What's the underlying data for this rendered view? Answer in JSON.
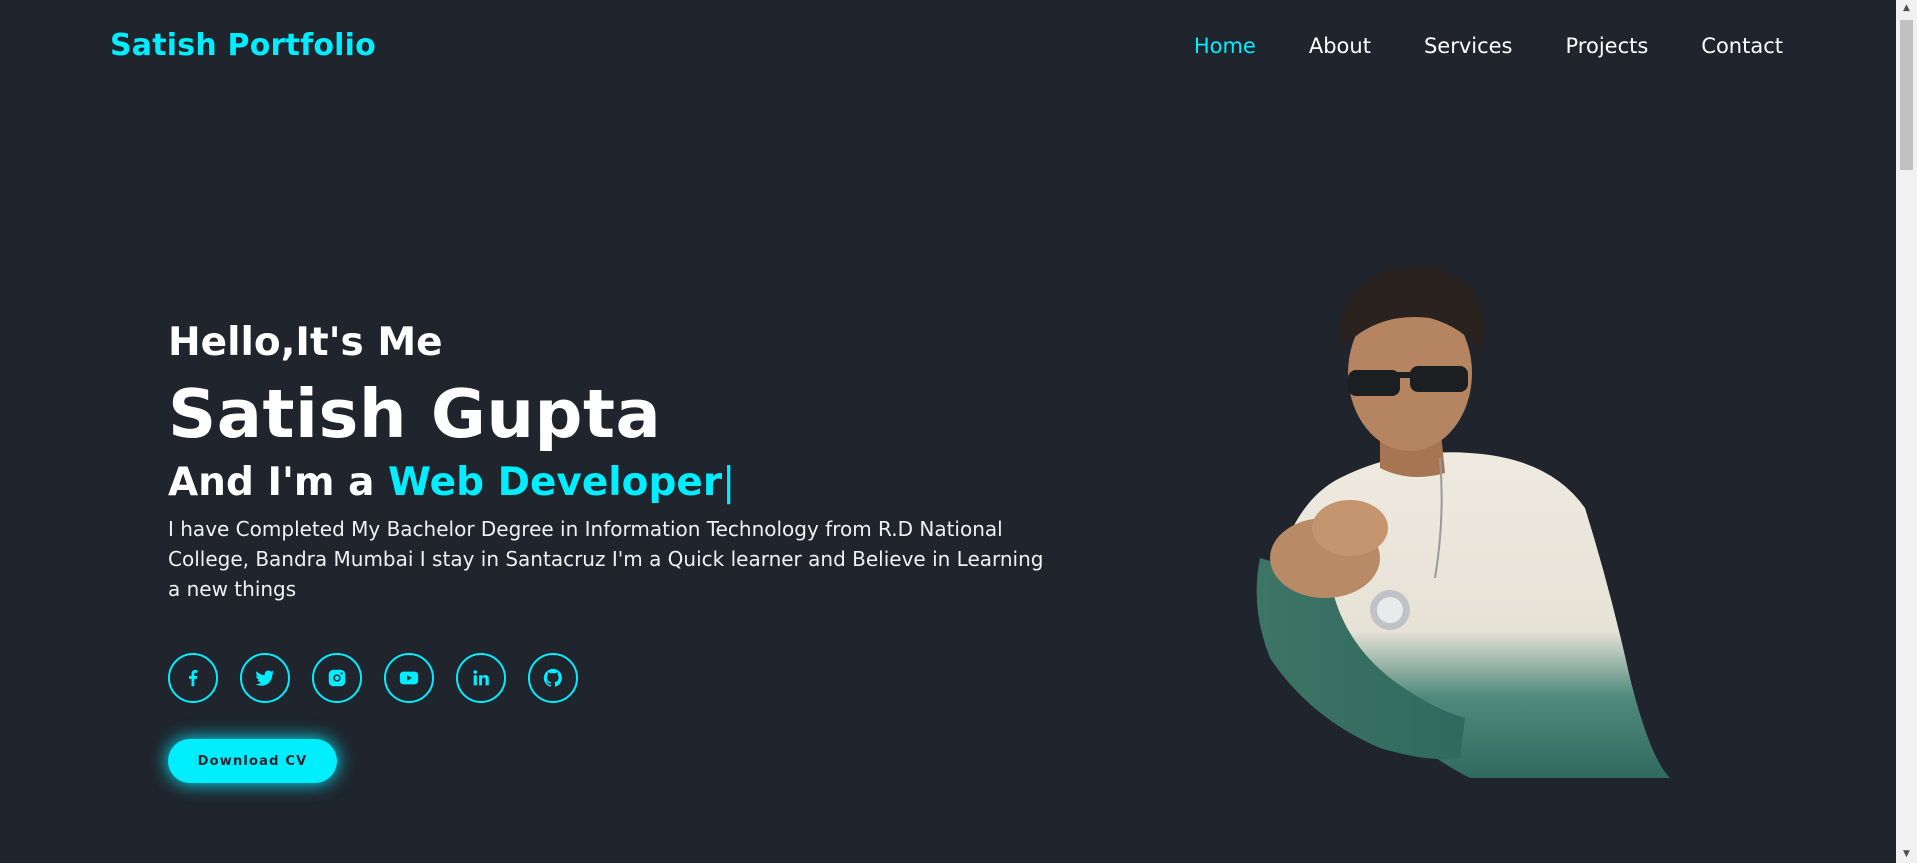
{
  "header": {
    "logo": "Satish Portfolio",
    "nav": [
      {
        "label": "Home",
        "active": true
      },
      {
        "label": "About",
        "active": false
      },
      {
        "label": "Services",
        "active": false
      },
      {
        "label": "Projects",
        "active": false
      },
      {
        "label": "Contact",
        "active": false
      }
    ]
  },
  "hero": {
    "greeting": "Hello,It's Me",
    "name": "Satish Gupta",
    "role_prefix": "And I'm a",
    "role_highlight": "Web Developer",
    "cursor": "|",
    "description": "I have Completed My Bachelor Degree in Information Technology from R.D National College, Bandra Mumbai I stay in Santacruz I'm a Quick learner and Believe in Learning a new things",
    "socials": [
      "facebook-icon",
      "twitter-icon",
      "instagram-icon",
      "youtube-icon",
      "linkedin-icon",
      "github-icon"
    ],
    "cv_button": "Download CV"
  },
  "theme": {
    "background": "#1f242d",
    "accent": "#00eeff",
    "text": "#ffffff"
  }
}
